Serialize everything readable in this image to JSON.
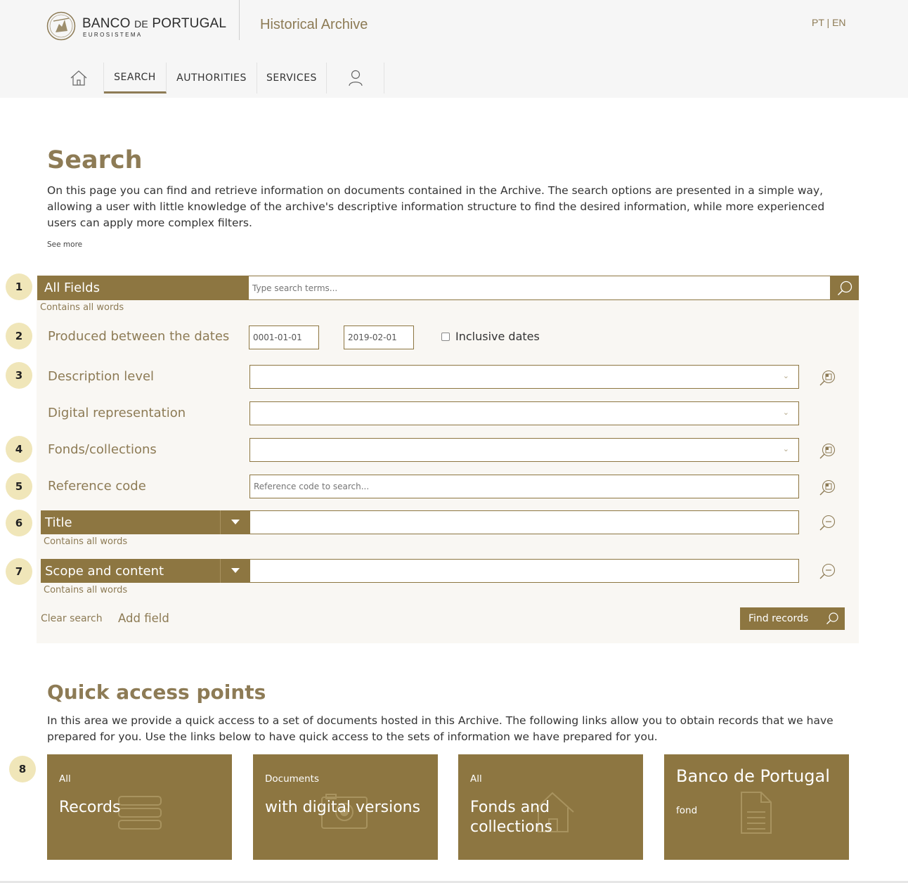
{
  "header": {
    "logo_name_main": "BANCO",
    "logo_name_de": "DE",
    "logo_name_end": "PORTUGAL",
    "logo_sub": "EUROSISTEMA",
    "archive_title": "Historical Archive",
    "lang_pt": "PT",
    "lang_sep": "|",
    "lang_en": "EN"
  },
  "nav": {
    "home_icon": "home-icon",
    "search": "SEARCH",
    "authorities": "AUTHORITIES",
    "services": "SERVICES",
    "user_icon": "user-icon"
  },
  "page": {
    "title": "Search",
    "intro": "On this page you can find and retrieve information on documents contained in the Archive. The search options are presented in a simple way, allowing a user with little knowledge of the archive's descriptive information structure to find the desired information, while more experienced users can apply more complex filters.",
    "see_more": "See more"
  },
  "bubbles": [
    "1",
    "2",
    "3",
    "4",
    "5",
    "6",
    "7",
    "8"
  ],
  "form": {
    "all_fields_label": "All Fields",
    "all_fields_placeholder": "Type search terms...",
    "contains_all_words": "Contains all words",
    "dates_label": "Produced between the dates",
    "date_from": "0001-01-01",
    "date_to": "2019-02-01",
    "inclusive_dates": "Inclusive dates",
    "description_level": "Description level",
    "digital_representation": "Digital representation",
    "fonds_collections": "Fonds/collections",
    "reference_code": "Reference code",
    "reference_placeholder": "Reference code to search...",
    "title_field": "Title",
    "scope_field": "Scope and content",
    "clear_search": "Clear search",
    "add_field": "Add field",
    "find_records": "Find records"
  },
  "quick_access": {
    "title": "Quick access points",
    "text": "In this area we provide a quick access to a set of documents hosted in this Archive. The following links allow you to obtain records that we have prepared for you. Use the links below to have quick access to the sets of information we have prepared for you.",
    "tiles": [
      {
        "small": "All",
        "big": "Records",
        "icon": "list-icon"
      },
      {
        "small": "Documents",
        "big": "with digital versions",
        "icon": "camera-icon"
      },
      {
        "small": "All",
        "big": "Fonds and collections",
        "icon": "house-icon"
      },
      {
        "big": "Banco de Portugal",
        "small": "fond",
        "icon": "document-icon"
      }
    ]
  },
  "colors": {
    "brand": "#8d7641",
    "brand_text": "#8d7b55",
    "bubble": "#f0e6b9",
    "panel": "#f9f7f3"
  }
}
